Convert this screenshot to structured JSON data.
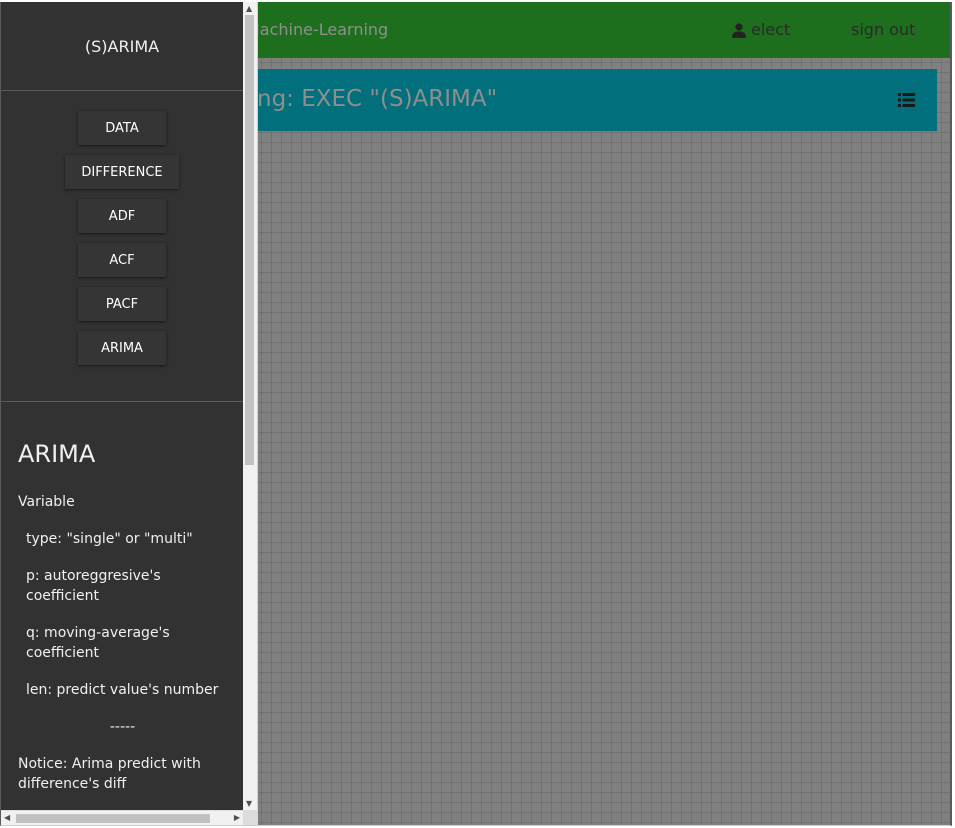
{
  "header": {
    "brand": "Machine-Learning",
    "user": "elect",
    "sign_out": "sign out"
  },
  "banner": {
    "title": "ng: EXEC \"(S)ARIMA\""
  },
  "sidebar": {
    "title": "(S)ARIMA",
    "buttons": [
      "DATA",
      "DIFFERENCE",
      "ADF",
      "ACF",
      "PACF",
      "ARIMA"
    ],
    "section_title": "ARIMA",
    "paragraphs": [
      "Variable",
      "type: \"single\" or \"multi\"",
      "p: autoreggresive's coefficient",
      "q: moving-average's coefficient",
      "len: predict value's number",
      "-----",
      "Notice: Arima predict with difference's diff"
    ]
  },
  "icons": {
    "user": "user-icon",
    "list": "list-icon"
  },
  "colors": {
    "topbar": "#1d6f1d",
    "banner": "#026f7c",
    "sidebar": "#323232",
    "canvas": "#808080"
  }
}
